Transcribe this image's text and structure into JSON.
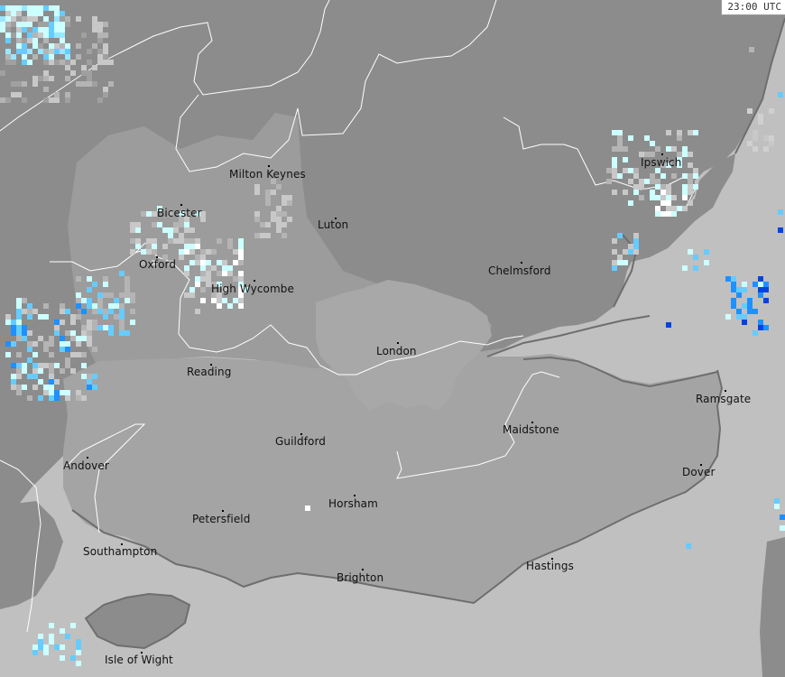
{
  "timestamp": "23:00 UTC",
  "colors": {
    "sea": "#c0c0c0",
    "land_far": "#8c8c8c",
    "land_mid": "#9c9c9c",
    "land_near": "#a4a4a4",
    "land_london": "#a8a8a8",
    "boundary": "#ffffff",
    "coast": "#6e6e6e",
    "rain_light": "#ccffff",
    "rain_moderate": "#66ccff",
    "rain_heavy": "#1e90ff",
    "rain_intense": "#0044dd"
  },
  "towns": [
    {
      "id": "milton-keynes",
      "name": "Milton Keynes"
    },
    {
      "id": "bicester",
      "name": "Bicester"
    },
    {
      "id": "luton",
      "name": "Luton"
    },
    {
      "id": "ipswich",
      "name": "Ipswich"
    },
    {
      "id": "oxford",
      "name": "Oxford"
    },
    {
      "id": "high-wycombe",
      "name": "High Wycombe"
    },
    {
      "id": "chelmsford",
      "name": "Chelmsford"
    },
    {
      "id": "london",
      "name": "London"
    },
    {
      "id": "reading",
      "name": "Reading"
    },
    {
      "id": "ramsgate",
      "name": "Ramsgate"
    },
    {
      "id": "guildford",
      "name": "Guildford"
    },
    {
      "id": "maidstone",
      "name": "Maidstone"
    },
    {
      "id": "andover",
      "name": "Andover"
    },
    {
      "id": "dover",
      "name": "Dover"
    },
    {
      "id": "horsham",
      "name": "Horsham"
    },
    {
      "id": "petersfield",
      "name": "Petersfield"
    },
    {
      "id": "southampton",
      "name": "Southampton"
    },
    {
      "id": "hastings",
      "name": "Hastings"
    },
    {
      "id": "brighton",
      "name": "Brighton"
    },
    {
      "id": "isle-of-wight",
      "name": "Isle of Wight"
    }
  ]
}
